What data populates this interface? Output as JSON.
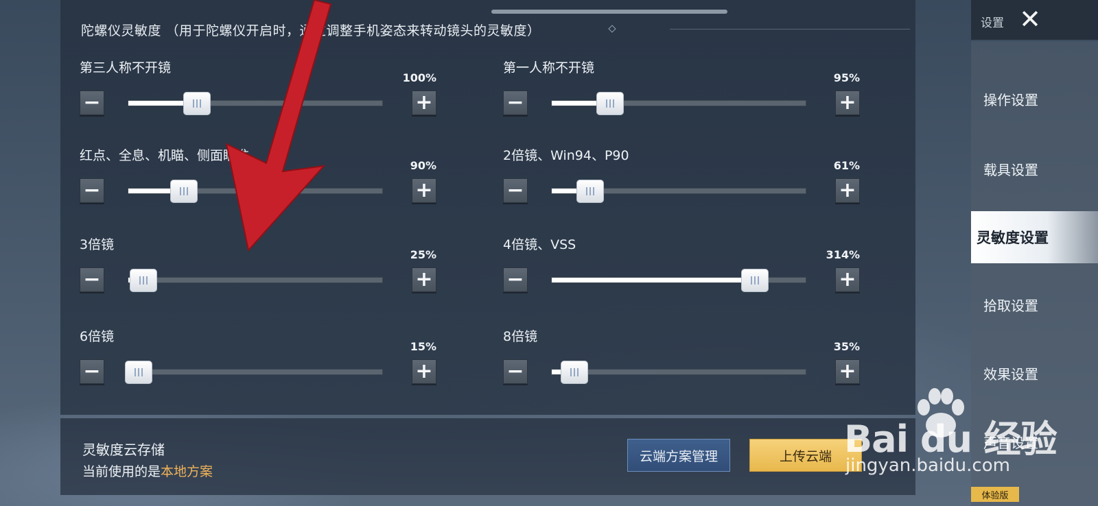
{
  "header": {
    "title": "陀螺仪灵敏度 （用于陀螺仪开启时，通过调整手机姿态来转动镜头的灵敏度）"
  },
  "sliders": [
    {
      "label": "第三人称不开镜",
      "percent_text": "100%",
      "level": 0.27
    },
    {
      "label": "第一人称不开镜",
      "percent_text": "95%",
      "level": 0.23
    },
    {
      "label": "红点、全息、机瞄、侧面瞄准",
      "percent_text": "90%",
      "level": 0.22
    },
    {
      "label": "2倍镜、Win94、P90",
      "percent_text": "61%",
      "level": 0.15
    },
    {
      "label": "3倍镜",
      "percent_text": "25%",
      "level": 0.06
    },
    {
      "label": "4倍镜、VSS",
      "percent_text": "314%",
      "level": 0.8
    },
    {
      "label": "6倍镜",
      "percent_text": "15%",
      "level": 0.04
    },
    {
      "label": "8倍镜",
      "percent_text": "35%",
      "level": 0.09
    }
  ],
  "buttons": {
    "minus": "−",
    "plus": "+"
  },
  "cloud": {
    "title": "灵敏度云存储",
    "sub_prefix": "当前使用的是",
    "sub_highlight": "本地方案",
    "manage_label": "云端方案管理",
    "upload_label": "上传云端"
  },
  "sidebar": {
    "top_label": "设置",
    "close_glyph": "✕",
    "items": [
      {
        "label": "操作设置"
      },
      {
        "label": "载具设置"
      },
      {
        "label": "灵敏度设置"
      },
      {
        "label": "拾取设置"
      },
      {
        "label": "效果设置"
      },
      {
        "label": "声音设置"
      }
    ],
    "badge": "体验版"
  },
  "watermark": {
    "brand": "Bai du 经验",
    "url": "jingyan.baidu.com"
  },
  "colors": {
    "accent_upload": "#e8b84c",
    "accent_manage": "#314e78",
    "highlight_text": "#f0b35a",
    "annotation_arrow": "#c8202a"
  }
}
